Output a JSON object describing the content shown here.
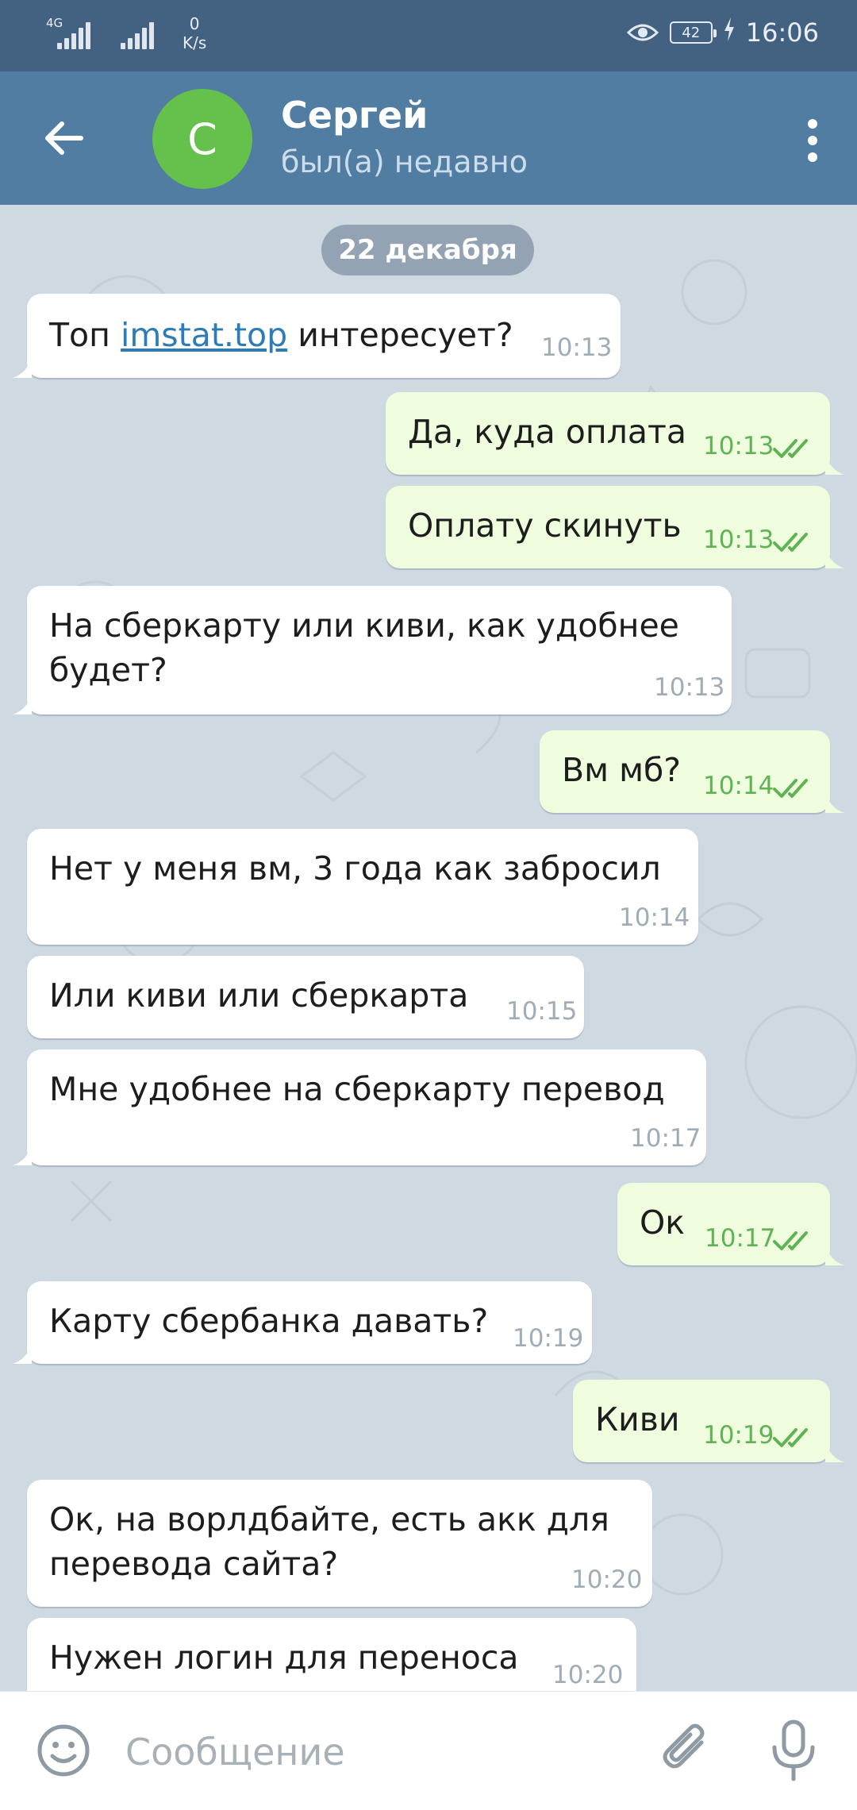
{
  "status_bar": {
    "network_type": "4G",
    "net_speed_value": "0",
    "net_speed_unit": "K/s",
    "battery": "42",
    "time": "16:06"
  },
  "header": {
    "avatar_letter": "C",
    "name": "Сергей",
    "status": "был(а) недавно"
  },
  "chat": {
    "date": "22 декабря",
    "messages": [
      {
        "dir": "in",
        "text_before": "Топ ",
        "link": "imstat.top",
        "text_after": " интересует?",
        "time": "10:13"
      },
      {
        "dir": "out",
        "text": "Да, куда оплата",
        "time": "10:13",
        "read": true
      },
      {
        "dir": "out",
        "text": "Оплату скинуть",
        "time": "10:13",
        "read": true
      },
      {
        "dir": "in",
        "line1": "На сберкарту или киви, как удобнее",
        "line2": "будет?",
        "time": "10:13"
      },
      {
        "dir": "out",
        "text": "Вм мб?",
        "time": "10:14",
        "read": true
      },
      {
        "dir": "in",
        "text": "Нет у меня вм, 3 года как забросил",
        "time": "10:14"
      },
      {
        "dir": "in",
        "text": "Или киви или сберкарта",
        "time": "10:15"
      },
      {
        "dir": "in",
        "text": "Мне удобнее на сберкарту перевод",
        "time": "10:17"
      },
      {
        "dir": "out",
        "text": "Ок",
        "time": "10:17",
        "read": true
      },
      {
        "dir": "in",
        "text": "Карту сбербанка давать?",
        "time": "10:19"
      },
      {
        "dir": "out",
        "text": "Киви",
        "time": "10:19",
        "read": true
      },
      {
        "dir": "in",
        "line1": "Ок, на ворлдбайте, есть акк для",
        "line2": "перевода сайта?",
        "time": "10:20"
      },
      {
        "dir": "in",
        "text": "Нужен логин для переноса",
        "time": "10:20"
      }
    ]
  },
  "input": {
    "placeholder": "Сообщение"
  },
  "icons": {
    "back": "arrow-left-icon",
    "menu": "more-vertical-icon",
    "emoji": "smiley-icon",
    "attach": "paperclip-icon",
    "mic": "microphone-icon",
    "read": "double-check-icon"
  },
  "colors": {
    "status_bar": "#436180",
    "header": "#527da3",
    "avatar": "#65c14b",
    "chat_bg": "#cfd9e1",
    "incoming_bubble": "#ffffff",
    "outgoing_bubble": "#effdde",
    "outgoing_time": "#5fb354",
    "link": "#2e7cb6"
  }
}
